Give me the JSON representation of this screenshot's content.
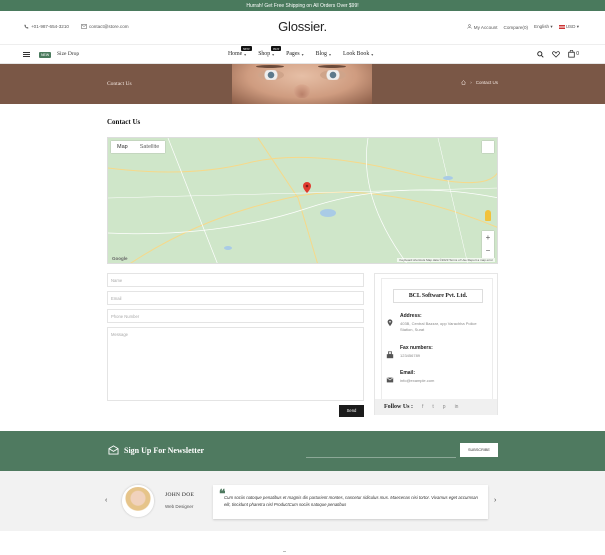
{
  "topbar": {
    "text": "Hurrah! Get Free Shipping on All Orders Over $99!"
  },
  "header": {
    "phone": "+01-987-654-3210",
    "email": "contact@store.com",
    "logo": "Glossier.",
    "account": "My Account",
    "compare": "Compare(0)",
    "language": "English",
    "currency": "USD"
  },
  "nav": {
    "new_tag": "NEW",
    "size_drop": "Size Drop",
    "items": [
      {
        "label": "Home",
        "badge": "NEW"
      },
      {
        "label": "Shop",
        "badge": "HOT"
      },
      {
        "label": "Pages",
        "badge": ""
      },
      {
        "label": "Blog",
        "badge": ""
      },
      {
        "label": "Look Book",
        "badge": ""
      }
    ],
    "cart_count": "0"
  },
  "hero": {
    "title": "Contact Us",
    "breadcrumb_current": "Contact Us"
  },
  "page": {
    "section_title": "Contact Us"
  },
  "map": {
    "tab_map": "Map",
    "tab_satellite": "Satellite",
    "footer": "Keyboard shortcuts   Map data ©2023   Terms of Use   Report a map error",
    "google": "Google"
  },
  "form": {
    "name_placeholder": "Name",
    "email_placeholder": "Email",
    "phone_placeholder": "Phone Number",
    "message_placeholder": "Message",
    "send_label": "Send"
  },
  "contact_card": {
    "company": "BCL Software Pvt. Ltd.",
    "address_label": "Address:",
    "address_value": "403B, Central Bazzar, opp Varachha Police Station, Surat",
    "fax_label": "Fax numbers:",
    "fax_value": "123456789",
    "email_label": "Email:",
    "email_value": "info@example.com",
    "follow_label": "Follow Us :",
    "socials": [
      "f",
      "t",
      "p",
      "in"
    ]
  },
  "newsletter": {
    "title": "Sign Up For Newsletter",
    "button": "SUBSCRIBE"
  },
  "testimonial": {
    "name": "JOHN DOE",
    "role": "Web Designer",
    "text": "Cum sociis natoque penatibus et magnis dis parturient montes, nascetur ridiculus mus. Maecenas nisi tortor. Vivamus eget accumsan elit, tincidunt pharetra nisl ProductCum sociis natoque penatibus",
    "prev": "‹",
    "next": "›"
  },
  "colors": {
    "brand_green": "#4a7a5d",
    "hero_brown": "#7a5746",
    "dark_button": "#1b1b1b"
  }
}
